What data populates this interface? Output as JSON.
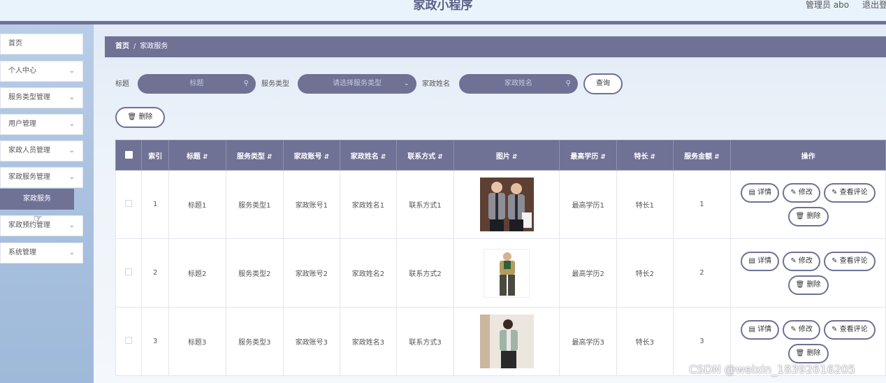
{
  "header": {
    "title": "家政小程序",
    "user": "管理员 abo",
    "logout": "退出登"
  },
  "sidebar": {
    "items": [
      {
        "label": "首页",
        "chevron": false
      },
      {
        "label": "个人中心",
        "chevron": true
      },
      {
        "label": "服务类型管理",
        "chevron": true
      },
      {
        "label": "用户管理",
        "chevron": true
      },
      {
        "label": "家政人员管理",
        "chevron": true
      },
      {
        "label": "家政服务管理",
        "chevron": true
      },
      {
        "label": "家政预约管理",
        "chevron": true
      },
      {
        "label": "系统管理",
        "chevron": true
      }
    ],
    "active_sub": "家政服务"
  },
  "breadcrumb": {
    "home": "首页",
    "separator": "/",
    "current": "家政服务"
  },
  "search": {
    "title_label": "标题",
    "title_placeholder": "标题",
    "type_label": "服务类型",
    "type_placeholder": "请选择服务类型",
    "name_label": "家政姓名",
    "name_placeholder": "家政姓名",
    "query_button": "查询",
    "delete_button": "删除"
  },
  "table": {
    "headers": [
      "索引",
      "标题",
      "服务类型",
      "家政账号",
      "家政姓名",
      "联系方式",
      "图片",
      "最高学历",
      "特长",
      "服务金额",
      "操作"
    ],
    "rows": [
      {
        "index": "1",
        "title": "标题1",
        "type": "服务类型1",
        "account": "家政账号1",
        "name": "家政姓名1",
        "contact": "联系方式1",
        "education": "最高学历1",
        "specialty": "特长1",
        "amount": "1"
      },
      {
        "index": "2",
        "title": "标题2",
        "type": "服务类型2",
        "account": "家政账号2",
        "name": "家政姓名2",
        "contact": "联系方式2",
        "education": "最高学历2",
        "specialty": "特长2",
        "amount": "2"
      },
      {
        "index": "3",
        "title": "标题3",
        "type": "服务类型3",
        "account": "家政账号3",
        "name": "家政姓名3",
        "contact": "联系方式3",
        "education": "最高学历3",
        "specialty": "特长3",
        "amount": "3"
      }
    ],
    "actions": {
      "detail": "详情",
      "edit": "修改",
      "comments": "查看评论",
      "delete": "删除"
    }
  },
  "watermark": "CSDN @weixin_18392616205",
  "colors": {
    "accent": "#6f7195",
    "sidebar": "#a9c1df",
    "topbar": "#e9f3fb"
  },
  "icons": {
    "search": "search-icon",
    "dropdown": "chevron-down-icon",
    "delete": "trash-icon",
    "detail": "document-icon",
    "edit": "pencil-icon"
  }
}
